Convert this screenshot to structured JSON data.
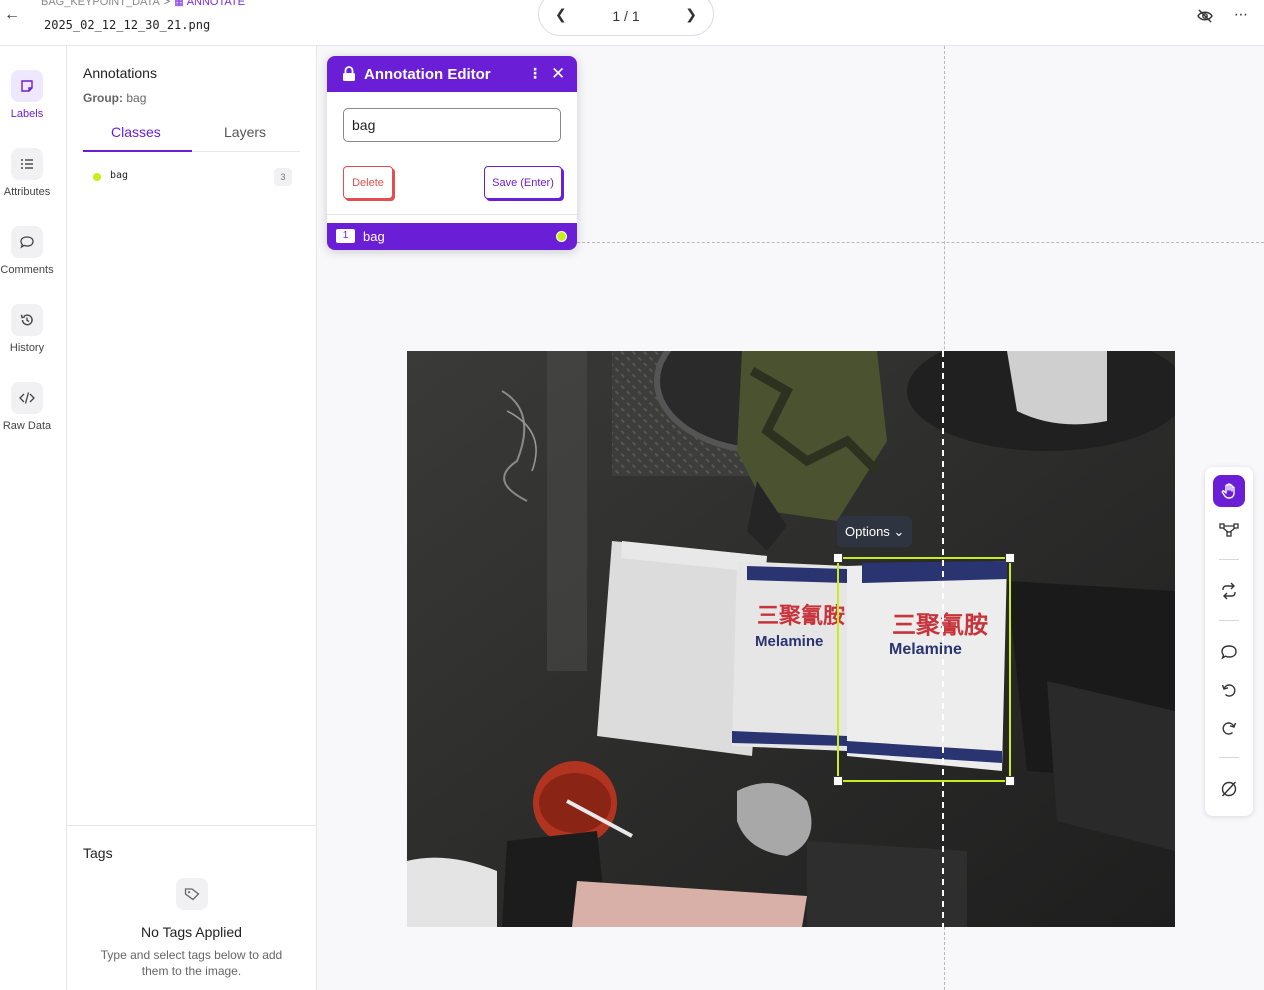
{
  "header": {
    "breadcrumb_project": "BAG_KEYPOINT_DATA",
    "breadcrumb_sep": ">",
    "breadcrumb_active": "ANNOTATE",
    "filename": "2025_02_12_12_30_21.png",
    "pager": "1 / 1"
  },
  "rail": {
    "labels": "Labels",
    "attributes": "Attributes",
    "comments": "Comments",
    "history": "History",
    "raw_data": "Raw Data"
  },
  "panel": {
    "title": "Annotations",
    "group_label": "Group:",
    "group_value": "bag",
    "tab_classes": "Classes",
    "tab_layers": "Layers",
    "classes": [
      {
        "name": "bag",
        "count": "3",
        "color": "#c7ee1a"
      }
    ]
  },
  "tags": {
    "title": "Tags",
    "empty_title": "No Tags Applied",
    "empty_desc": "Type and select tags below to add them to the image."
  },
  "editor": {
    "title": "Annotation Editor",
    "input_value": "bag",
    "delete_label": "Delete",
    "save_label": "Save (Enter)",
    "layer_number": "1",
    "layer_name": "bag"
  },
  "canvas": {
    "options_label": "Options"
  },
  "colors": {
    "accent": "#6a1fd6",
    "bbox": "#c7ee1a",
    "delete": "#e05050"
  },
  "icons": [
    "back-arrow-icon",
    "annotate-icon",
    "chevron-left-icon",
    "chevron-right-icon",
    "eye-off-icon",
    "more-horizontal-icon",
    "label-icon",
    "list-icon",
    "comment-icon",
    "history-icon",
    "code-icon",
    "tag-icon",
    "lock-icon",
    "more-vertical-icon",
    "close-icon",
    "chevron-down-icon",
    "hand-icon",
    "graph-icon",
    "repeat-icon",
    "undo-icon",
    "redo-icon",
    "hide-icon"
  ]
}
